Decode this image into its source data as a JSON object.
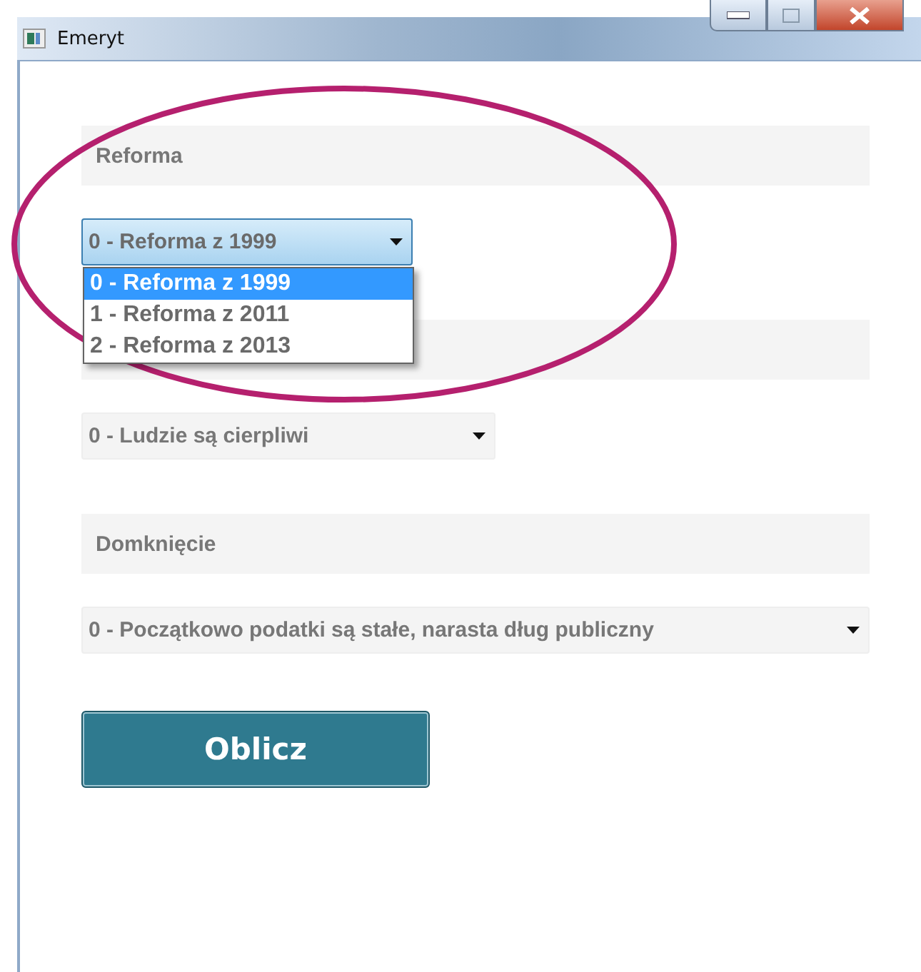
{
  "window": {
    "title": "Emeryt"
  },
  "sections": [
    {
      "label": "Reforma",
      "combo": {
        "value": "0 - Reforma z 1999",
        "expanded": true,
        "options": [
          {
            "label": "0 - Reforma z 1999",
            "selected": true
          },
          {
            "label": "1 - Reforma z 2011",
            "selected": false
          },
          {
            "label": "2 - Reforma z 2013",
            "selected": false
          }
        ]
      }
    },
    {
      "combo": {
        "value": "0 - Ludzie są cierpliwi",
        "expanded": false
      }
    },
    {
      "label": "Domknięcie",
      "combo": {
        "value": "0 - Początkowo podatki są stałe, narasta dług publiczny",
        "expanded": false
      }
    }
  ],
  "button": "Oblicz",
  "annotation": {
    "kind": "ellipse"
  }
}
